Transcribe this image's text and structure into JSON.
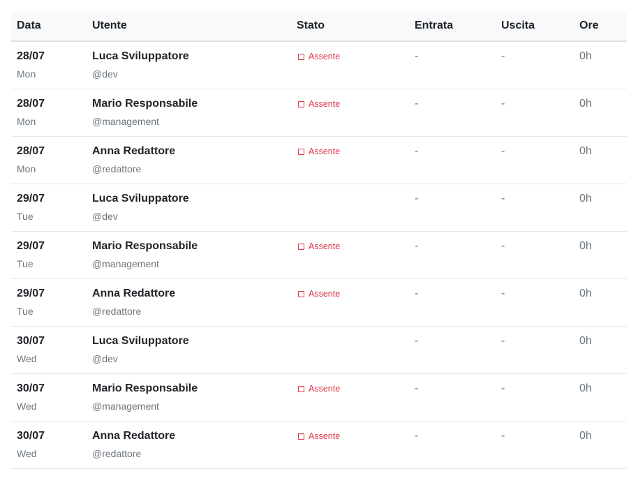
{
  "columns": {
    "data": "Data",
    "utente": "Utente",
    "stato": "Stato",
    "entrata": "Entrata",
    "uscita": "Uscita",
    "ore": "Ore"
  },
  "colors": {
    "absent": "#dc3545",
    "muted": "#6c757d",
    "header_bg": "#f8f9fa"
  },
  "rows": [
    {
      "date": "28/07",
      "day": "Mon",
      "name": "Luca Sviluppatore",
      "handle": "@dev",
      "status": "Assente",
      "status_icon": "square-outline-icon",
      "in": "-",
      "out": "-",
      "hours": "0h"
    },
    {
      "date": "28/07",
      "day": "Mon",
      "name": "Mario Responsabile",
      "handle": "@management",
      "status": "Assente",
      "status_icon": "square-outline-icon",
      "in": "-",
      "out": "-",
      "hours": "0h"
    },
    {
      "date": "28/07",
      "day": "Mon",
      "name": "Anna Redattore",
      "handle": "@redattore",
      "status": "Assente",
      "status_icon": "square-outline-icon",
      "in": "-",
      "out": "-",
      "hours": "0h"
    },
    {
      "date": "29/07",
      "day": "Tue",
      "name": "Luca Sviluppatore",
      "handle": "@dev",
      "status": "",
      "status_icon": "",
      "in": "-",
      "out": "-",
      "hours": "0h"
    },
    {
      "date": "29/07",
      "day": "Tue",
      "name": "Mario Responsabile",
      "handle": "@management",
      "status": "Assente",
      "status_icon": "square-outline-icon",
      "in": "-",
      "out": "-",
      "hours": "0h"
    },
    {
      "date": "29/07",
      "day": "Tue",
      "name": "Anna Redattore",
      "handle": "@redattore",
      "status": "Assente",
      "status_icon": "square-outline-icon",
      "in": "-",
      "out": "-",
      "hours": "0h"
    },
    {
      "date": "30/07",
      "day": "Wed",
      "name": "Luca Sviluppatore",
      "handle": "@dev",
      "status": "",
      "status_icon": "",
      "in": "-",
      "out": "-",
      "hours": "0h"
    },
    {
      "date": "30/07",
      "day": "Wed",
      "name": "Mario Responsabile",
      "handle": "@management",
      "status": "Assente",
      "status_icon": "square-outline-icon",
      "in": "-",
      "out": "-",
      "hours": "0h"
    },
    {
      "date": "30/07",
      "day": "Wed",
      "name": "Anna Redattore",
      "handle": "@redattore",
      "status": "Assente",
      "status_icon": "square-outline-icon",
      "in": "-",
      "out": "-",
      "hours": "0h"
    }
  ]
}
